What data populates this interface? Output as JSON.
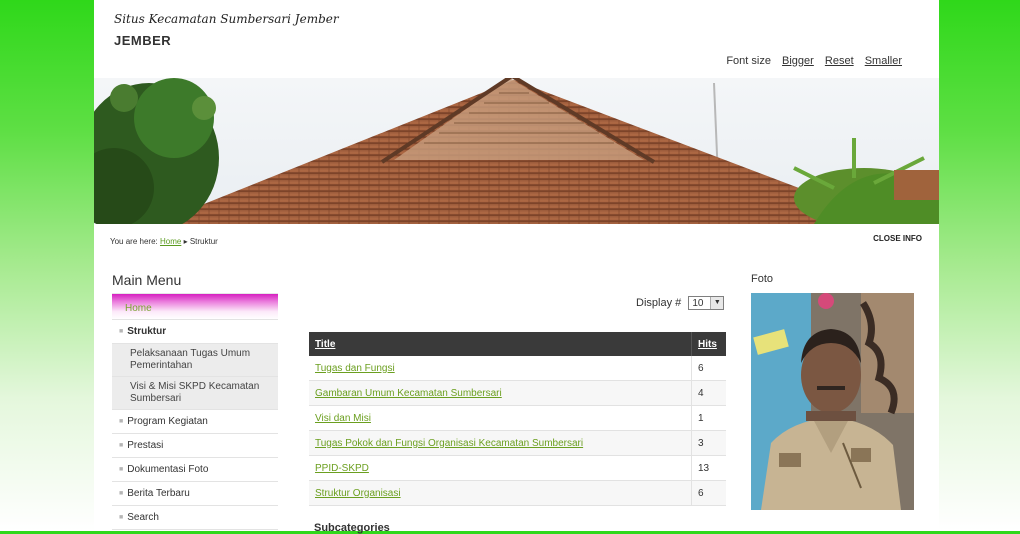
{
  "header": {
    "site_title": "Situs Kecamatan Sumbersari Jember",
    "site_sub": "JEMBER",
    "font_size_label": "Font size",
    "bigger": "Bigger",
    "reset": "Reset",
    "smaller": "Smaller"
  },
  "breadcrumb": {
    "prefix": "You are here:",
    "home": "Home",
    "separator": "▸",
    "current": "Struktur"
  },
  "close_info": "CLOSE INFO",
  "menu": {
    "title": "Main Menu",
    "items": [
      {
        "label": "Home"
      },
      {
        "label": "Struktur"
      },
      {
        "label": "Pelaksanaan Tugas Umum Pemerintahan"
      },
      {
        "label": "Visi & Misi SKPD Kecamatan Sumbersari"
      },
      {
        "label": "Program Kegiatan"
      },
      {
        "label": "Prestasi"
      },
      {
        "label": "Dokumentasi Foto"
      },
      {
        "label": "Berita Terbaru"
      },
      {
        "label": "Search"
      }
    ]
  },
  "display": {
    "label": "Display #",
    "value": "10"
  },
  "table": {
    "headers": {
      "title": "Title",
      "hits": "Hits"
    },
    "rows": [
      {
        "title": "Tugas dan Fungsi",
        "hits": "6"
      },
      {
        "title": "Gambaran Umum Kecamatan Sumbersari",
        "hits": "4"
      },
      {
        "title": "Visi dan Misi",
        "hits": "1"
      },
      {
        "title": "Tugas Pokok dan Fungsi Organisasi Kecamatan Sumbersari",
        "hits": "3"
      },
      {
        "title": "PPID-SKPD",
        "hits": "13"
      },
      {
        "title": "Struktur Organisasi",
        "hits": "6"
      }
    ]
  },
  "subcategories": "Subcategories",
  "foto": {
    "title": "Foto"
  },
  "colors": {
    "accent_green": "#6b9f1f",
    "menu_home_pink": "#d61fc0",
    "bg_green": "#2fd81a",
    "table_header": "#3a3a3a"
  }
}
